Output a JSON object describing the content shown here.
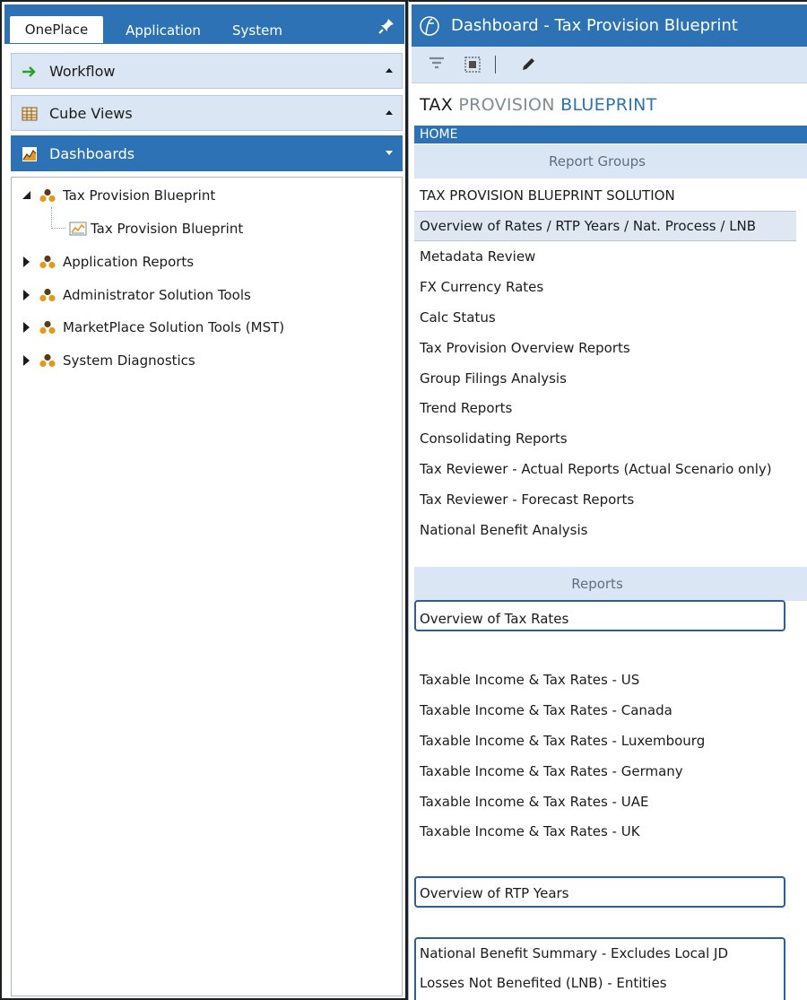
{
  "left_tabs": {
    "items": [
      "OnePlace",
      "Application",
      "System"
    ],
    "active": "OnePlace"
  },
  "panels": {
    "workflow": "Workflow",
    "cube_views": "Cube Views",
    "dashboards": "Dashboards"
  },
  "tree": {
    "root": "Tax Provision Blueprint",
    "child": "Tax Provision Blueprint",
    "groups": [
      "Application Reports",
      "Administrator Solution Tools",
      "MarketPlace Solution Tools (MST)",
      "System Diagnostics"
    ]
  },
  "dashboard": {
    "window_title": "Dashboard - Tax Provision Blueprint",
    "title_part1": "TAX",
    "title_part2": "PROVISION",
    "title_part3": "BLUEPRINT",
    "home_label": "HOME",
    "report_groups_header": "Report Groups",
    "report_groups": [
      "TAX PROVISION BLUEPRINT SOLUTION",
      "Overview of Rates / RTP Years / Nat. Process / LNB",
      "Metadata Review",
      "FX Currency Rates",
      "Calc Status",
      "Tax Provision Overview Reports",
      "Group Filings Analysis",
      "Trend Reports",
      "Consolidating Reports",
      "Tax Reviewer - Actual Reports  (Actual Scenario only)",
      "Tax Reviewer - Forecast Reports",
      "National Benefit Analysis"
    ],
    "selected_group": "Overview of Rates / RTP Years / Nat. Process / LNB",
    "reports_header": "Reports",
    "reports": {
      "overview_tax_rates": "Overview of Tax Rates",
      "taxable_income": [
        "Taxable Income & Tax Rates - US",
        "Taxable Income & Tax Rates - Canada",
        "Taxable Income & Tax Rates - Luxembourg",
        "Taxable Income & Tax Rates - Germany",
        "Taxable Income & Tax Rates - UAE",
        "Taxable Income & Tax Rates - UK"
      ],
      "overview_rtp_years": "Overview of RTP Years",
      "national_benefit_summary": "National Benefit Summary - Excludes Local JD",
      "lnb_entities": "Losses Not Benefited (LNB) - Entities"
    }
  },
  "colors": {
    "accent": "#2d72b4",
    "panel": "#dbe6f4",
    "box_outline": "#2a5f97",
    "group_icon_orange": "#e39a1d",
    "group_icon_dark": "#5a3a16",
    "arrow_green": "#2aa12a"
  },
  "icons": [
    "pin-icon",
    "arrow-right-icon",
    "grid-icon",
    "chart-icon",
    "caret-icon",
    "group-icon",
    "logo-icon",
    "filter-icon",
    "select-icon",
    "pencil-icon"
  ]
}
